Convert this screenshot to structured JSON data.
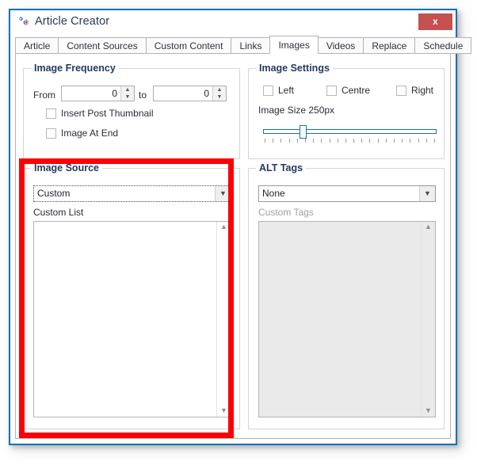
{
  "window": {
    "title": "Article Creator",
    "app_icon": "gear-icon",
    "close_label": "x",
    "border_color": "#1172b8"
  },
  "tabs": [
    {
      "label": "Article",
      "selected": false
    },
    {
      "label": "Content Sources",
      "selected": false
    },
    {
      "label": "Custom Content",
      "selected": false
    },
    {
      "label": "Links",
      "selected": false
    },
    {
      "label": "Images",
      "selected": true
    },
    {
      "label": "Videos",
      "selected": false
    },
    {
      "label": "Replace",
      "selected": false
    },
    {
      "label": "Schedule",
      "selected": false
    }
  ],
  "image_frequency": {
    "title": "Image Frequency",
    "from_label": "From",
    "from_value": "0",
    "to_label": "to",
    "to_value": "0",
    "checkboxes": [
      {
        "label": "Insert Post Thumbnail",
        "checked": false
      },
      {
        "label": "Image At End",
        "checked": false
      }
    ]
  },
  "image_settings": {
    "title": "Image Settings",
    "alignment": [
      {
        "label": "Left",
        "checked": false
      },
      {
        "label": "Centre",
        "checked": false
      },
      {
        "label": "Right",
        "checked": false
      }
    ],
    "size_label": "Image Size 250px",
    "slider": {
      "value": 250,
      "thumb_percent": 22,
      "tick_count": 22,
      "accent": "#1172b8"
    }
  },
  "image_source": {
    "title": "Image Source",
    "source_value": "Custom",
    "source_arrow": "chevron-down-icon",
    "list_label": "Custom List",
    "list_value": "",
    "scroll_up": "chevron-up-icon",
    "scroll_down": "chevron-down-icon"
  },
  "alt_tags": {
    "title": "ALT Tags",
    "tags_value": "None",
    "tags_arrow": "chevron-down-icon",
    "custom_label": "Custom Tags",
    "custom_value": "",
    "custom_disabled": true,
    "scroll_up": "chevron-up-icon",
    "scroll_down": "chevron-down-icon"
  },
  "annotation": {
    "highlight_color": "#fb0007",
    "highlight_target": "image-source-group"
  }
}
